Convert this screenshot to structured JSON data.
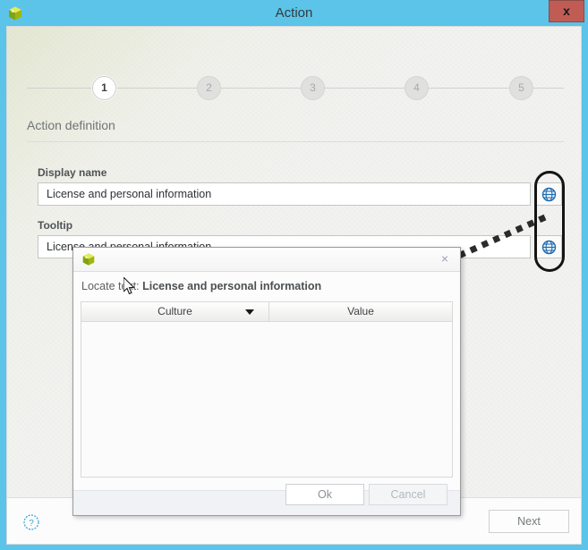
{
  "window": {
    "title": "Action",
    "app_icon": "cube-icon",
    "close_label": "x"
  },
  "wizard": {
    "steps": [
      {
        "number": "1",
        "state": "active"
      },
      {
        "number": "2",
        "state": "inactive"
      },
      {
        "number": "3",
        "state": "inactive"
      },
      {
        "number": "4",
        "state": "inactive"
      },
      {
        "number": "5",
        "state": "inactive"
      }
    ],
    "section_title": "Action definition",
    "fields": [
      {
        "label": "Display name",
        "value": "License and personal information",
        "placeholder": "",
        "button_icon": "globe-icon"
      },
      {
        "label": "Tooltip",
        "value": "License and personal information",
        "placeholder": "",
        "button_icon": "globe-icon"
      }
    ],
    "footer": {
      "help_icon": "help-circle-icon",
      "next_label": "Next"
    }
  },
  "dialog": {
    "app_icon": "cube-icon",
    "close_label": "×",
    "locate_prefix": "Locate text:",
    "locate_value": "License and personal information",
    "grid": {
      "columns": [
        {
          "label": "Culture",
          "sort": "descending"
        },
        {
          "label": "Value",
          "sort": "none"
        }
      ],
      "rows": []
    },
    "buttons": {
      "ok_label": "Ok",
      "cancel_label": "Cancel"
    }
  },
  "annotations": {
    "oval": "highlight-oval",
    "arrow": "pointer-arrow"
  },
  "colors": {
    "titlebar": "#5bc4e8",
    "close_button": "#c15c54",
    "globe_icon": "#1f6bb0",
    "help_icon": "#3ba7d6",
    "content_bg": "#f2f2f0"
  }
}
